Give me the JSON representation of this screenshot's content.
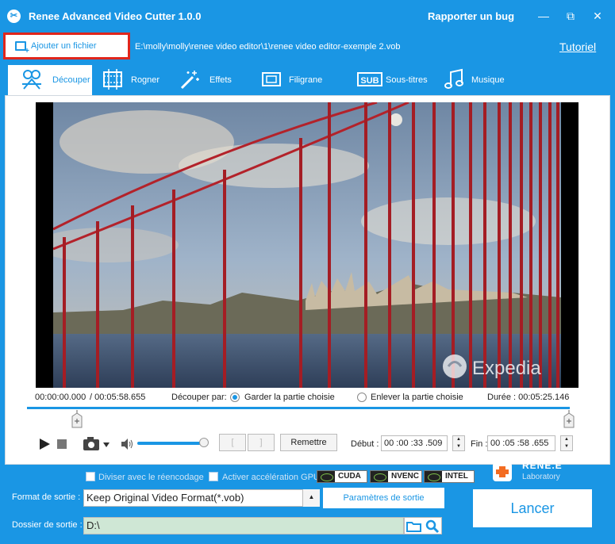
{
  "window": {
    "title": "Renee Advanced Video Cutter 1.0.0",
    "report_bug": "Rapporter un bug",
    "minimize": "—",
    "maximize": "⧉",
    "close": "✕"
  },
  "file": {
    "add_label": "Ajouter un fichier",
    "path": "E:\\molly\\molly\\renee video editor\\1\\renee video editor-exemple 2.vob",
    "tutorial": "Tutoriel"
  },
  "tabs": [
    {
      "label": "Découper",
      "icon": "scissors-reel-icon",
      "active": true
    },
    {
      "label": "Rogner",
      "icon": "film-crop-icon"
    },
    {
      "label": "Effets",
      "icon": "magic-wand-icon"
    },
    {
      "label": "Filigrane",
      "icon": "watermark-icon"
    },
    {
      "label": "Sous-titres",
      "icon": "subtitle-icon"
    },
    {
      "label": "Musique",
      "icon": "music-note-icon"
    }
  ],
  "video": {
    "watermark_text": "Expedia"
  },
  "cut": {
    "position": "00:00:00.000",
    "total": "/ 00:05:58.655",
    "cut_by_label": "Découper par:",
    "keep_label": "Garder la partie choisie",
    "remove_label": "Enlever la partie choisie",
    "duration": "Durée : 00:05:25.146",
    "reset": "Remettre",
    "start_label": "Début :",
    "start_time": "00 :00 :33 .509",
    "end_label": "Fin :",
    "end_time": "00 :05 :58 .655",
    "bracket_in": "[",
    "bracket_out": "]",
    "selected_mode": "keep"
  },
  "output": {
    "split_reencode": "Diviser avec le réencodage",
    "gpu_accel": "Activer accélération GPU",
    "gpu_options": [
      "CUDA",
      "NVENC",
      "INTEL"
    ],
    "format_label": "Format de sortie :",
    "format_value": "Keep Original Video Format(*.vob)",
    "params_button": "Paramètres de sortie",
    "folder_label": "Dossier de sortie :",
    "folder_value": "D:\\",
    "launch": "Lancer"
  },
  "brand": {
    "name": "RENE.E",
    "sub": "Laboratory"
  },
  "colors": {
    "accent": "#1a96e4",
    "highlight": "#e0261c",
    "folder_bg": "#cfe7d5"
  }
}
